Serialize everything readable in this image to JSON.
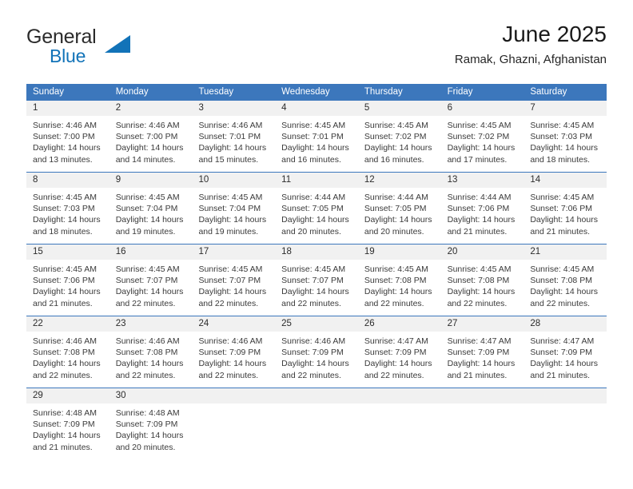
{
  "brand": {
    "name_part1": "General",
    "name_part2": "Blue",
    "triangle_color": "#1273b8"
  },
  "header": {
    "title": "June 2025",
    "subtitle": "Ramak, Ghazni, Afghanistan"
  },
  "colors": {
    "header_blue": "#3c77bc",
    "day_number_bg": "#f1f1f1",
    "text": "#3a3a3a",
    "brand_blue": "#1273b8"
  },
  "weekdays": [
    "Sunday",
    "Monday",
    "Tuesday",
    "Wednesday",
    "Thursday",
    "Friday",
    "Saturday"
  ],
  "weeks": [
    {
      "days": [
        {
          "number": "1",
          "sunrise": "Sunrise: 4:46 AM",
          "sunset": "Sunset: 7:00 PM",
          "daylight1": "Daylight: 14 hours",
          "daylight2": "and 13 minutes."
        },
        {
          "number": "2",
          "sunrise": "Sunrise: 4:46 AM",
          "sunset": "Sunset: 7:00 PM",
          "daylight1": "Daylight: 14 hours",
          "daylight2": "and 14 minutes."
        },
        {
          "number": "3",
          "sunrise": "Sunrise: 4:46 AM",
          "sunset": "Sunset: 7:01 PM",
          "daylight1": "Daylight: 14 hours",
          "daylight2": "and 15 minutes."
        },
        {
          "number": "4",
          "sunrise": "Sunrise: 4:45 AM",
          "sunset": "Sunset: 7:01 PM",
          "daylight1": "Daylight: 14 hours",
          "daylight2": "and 16 minutes."
        },
        {
          "number": "5",
          "sunrise": "Sunrise: 4:45 AM",
          "sunset": "Sunset: 7:02 PM",
          "daylight1": "Daylight: 14 hours",
          "daylight2": "and 16 minutes."
        },
        {
          "number": "6",
          "sunrise": "Sunrise: 4:45 AM",
          "sunset": "Sunset: 7:02 PM",
          "daylight1": "Daylight: 14 hours",
          "daylight2": "and 17 minutes."
        },
        {
          "number": "7",
          "sunrise": "Sunrise: 4:45 AM",
          "sunset": "Sunset: 7:03 PM",
          "daylight1": "Daylight: 14 hours",
          "daylight2": "and 18 minutes."
        }
      ]
    },
    {
      "days": [
        {
          "number": "8",
          "sunrise": "Sunrise: 4:45 AM",
          "sunset": "Sunset: 7:03 PM",
          "daylight1": "Daylight: 14 hours",
          "daylight2": "and 18 minutes."
        },
        {
          "number": "9",
          "sunrise": "Sunrise: 4:45 AM",
          "sunset": "Sunset: 7:04 PM",
          "daylight1": "Daylight: 14 hours",
          "daylight2": "and 19 minutes."
        },
        {
          "number": "10",
          "sunrise": "Sunrise: 4:45 AM",
          "sunset": "Sunset: 7:04 PM",
          "daylight1": "Daylight: 14 hours",
          "daylight2": "and 19 minutes."
        },
        {
          "number": "11",
          "sunrise": "Sunrise: 4:44 AM",
          "sunset": "Sunset: 7:05 PM",
          "daylight1": "Daylight: 14 hours",
          "daylight2": "and 20 minutes."
        },
        {
          "number": "12",
          "sunrise": "Sunrise: 4:44 AM",
          "sunset": "Sunset: 7:05 PM",
          "daylight1": "Daylight: 14 hours",
          "daylight2": "and 20 minutes."
        },
        {
          "number": "13",
          "sunrise": "Sunrise: 4:44 AM",
          "sunset": "Sunset: 7:06 PM",
          "daylight1": "Daylight: 14 hours",
          "daylight2": "and 21 minutes."
        },
        {
          "number": "14",
          "sunrise": "Sunrise: 4:45 AM",
          "sunset": "Sunset: 7:06 PM",
          "daylight1": "Daylight: 14 hours",
          "daylight2": "and 21 minutes."
        }
      ]
    },
    {
      "days": [
        {
          "number": "15",
          "sunrise": "Sunrise: 4:45 AM",
          "sunset": "Sunset: 7:06 PM",
          "daylight1": "Daylight: 14 hours",
          "daylight2": "and 21 minutes."
        },
        {
          "number": "16",
          "sunrise": "Sunrise: 4:45 AM",
          "sunset": "Sunset: 7:07 PM",
          "daylight1": "Daylight: 14 hours",
          "daylight2": "and 22 minutes."
        },
        {
          "number": "17",
          "sunrise": "Sunrise: 4:45 AM",
          "sunset": "Sunset: 7:07 PM",
          "daylight1": "Daylight: 14 hours",
          "daylight2": "and 22 minutes."
        },
        {
          "number": "18",
          "sunrise": "Sunrise: 4:45 AM",
          "sunset": "Sunset: 7:07 PM",
          "daylight1": "Daylight: 14 hours",
          "daylight2": "and 22 minutes."
        },
        {
          "number": "19",
          "sunrise": "Sunrise: 4:45 AM",
          "sunset": "Sunset: 7:08 PM",
          "daylight1": "Daylight: 14 hours",
          "daylight2": "and 22 minutes."
        },
        {
          "number": "20",
          "sunrise": "Sunrise: 4:45 AM",
          "sunset": "Sunset: 7:08 PM",
          "daylight1": "Daylight: 14 hours",
          "daylight2": "and 22 minutes."
        },
        {
          "number": "21",
          "sunrise": "Sunrise: 4:45 AM",
          "sunset": "Sunset: 7:08 PM",
          "daylight1": "Daylight: 14 hours",
          "daylight2": "and 22 minutes."
        }
      ]
    },
    {
      "days": [
        {
          "number": "22",
          "sunrise": "Sunrise: 4:46 AM",
          "sunset": "Sunset: 7:08 PM",
          "daylight1": "Daylight: 14 hours",
          "daylight2": "and 22 minutes."
        },
        {
          "number": "23",
          "sunrise": "Sunrise: 4:46 AM",
          "sunset": "Sunset: 7:08 PM",
          "daylight1": "Daylight: 14 hours",
          "daylight2": "and 22 minutes."
        },
        {
          "number": "24",
          "sunrise": "Sunrise: 4:46 AM",
          "sunset": "Sunset: 7:09 PM",
          "daylight1": "Daylight: 14 hours",
          "daylight2": "and 22 minutes."
        },
        {
          "number": "25",
          "sunrise": "Sunrise: 4:46 AM",
          "sunset": "Sunset: 7:09 PM",
          "daylight1": "Daylight: 14 hours",
          "daylight2": "and 22 minutes."
        },
        {
          "number": "26",
          "sunrise": "Sunrise: 4:47 AM",
          "sunset": "Sunset: 7:09 PM",
          "daylight1": "Daylight: 14 hours",
          "daylight2": "and 22 minutes."
        },
        {
          "number": "27",
          "sunrise": "Sunrise: 4:47 AM",
          "sunset": "Sunset: 7:09 PM",
          "daylight1": "Daylight: 14 hours",
          "daylight2": "and 21 minutes."
        },
        {
          "number": "28",
          "sunrise": "Sunrise: 4:47 AM",
          "sunset": "Sunset: 7:09 PM",
          "daylight1": "Daylight: 14 hours",
          "daylight2": "and 21 minutes."
        }
      ]
    },
    {
      "days": [
        {
          "number": "29",
          "sunrise": "Sunrise: 4:48 AM",
          "sunset": "Sunset: 7:09 PM",
          "daylight1": "Daylight: 14 hours",
          "daylight2": "and 21 minutes."
        },
        {
          "number": "30",
          "sunrise": "Sunrise: 4:48 AM",
          "sunset": "Sunset: 7:09 PM",
          "daylight1": "Daylight: 14 hours",
          "daylight2": "and 20 minutes."
        },
        {
          "number": "",
          "sunrise": "",
          "sunset": "",
          "daylight1": "",
          "daylight2": ""
        },
        {
          "number": "",
          "sunrise": "",
          "sunset": "",
          "daylight1": "",
          "daylight2": ""
        },
        {
          "number": "",
          "sunrise": "",
          "sunset": "",
          "daylight1": "",
          "daylight2": ""
        },
        {
          "number": "",
          "sunrise": "",
          "sunset": "",
          "daylight1": "",
          "daylight2": ""
        },
        {
          "number": "",
          "sunrise": "",
          "sunset": "",
          "daylight1": "",
          "daylight2": ""
        }
      ]
    }
  ]
}
